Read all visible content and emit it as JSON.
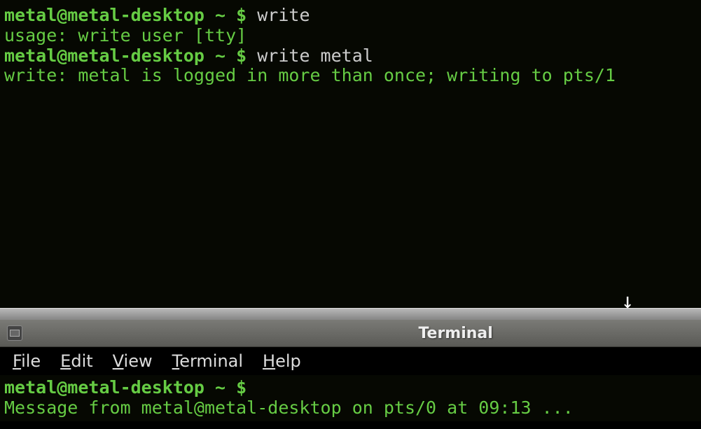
{
  "top": {
    "line1": {
      "prompt": "metal@metal-desktop ",
      "path": "~ ",
      "dollar": "$ ",
      "cmd": "write"
    },
    "line2": "usage: write user [tty]",
    "line3": {
      "prompt": "metal@metal-desktop ",
      "path": "~ ",
      "dollar": "$ ",
      "cmd": "write metal"
    },
    "line4": "write: metal is logged in more than once; writing to pts/1"
  },
  "window": {
    "title": "Terminal"
  },
  "menu": {
    "file": "File",
    "edit": "Edit",
    "view": "View",
    "terminal": "Terminal",
    "help": "Help"
  },
  "bottom": {
    "line1": {
      "prompt": "metal@metal-desktop ",
      "path": "~ ",
      "dollar": "$"
    },
    "line2": "Message from metal@metal-desktop on pts/0 at 09:13 ..."
  }
}
